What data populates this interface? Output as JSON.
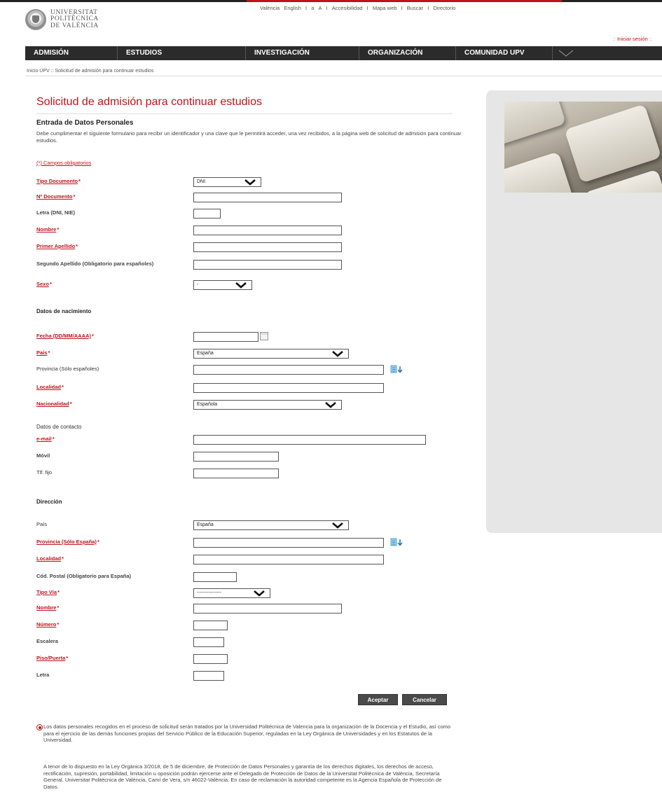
{
  "header": {
    "logo_text": [
      "UNIVERSITAT",
      "POLITÈCNICA",
      "DE VALÈNCIA"
    ],
    "top_links": [
      "València",
      "English",
      "I",
      "a",
      "A",
      "I",
      "Accesibilidad",
      "I",
      "Mapa web",
      "I",
      "Buscar",
      "I",
      "Directorio"
    ],
    "login_prefix": "::",
    "login_label": "Iniciar sesión",
    "login_suffix": "::"
  },
  "nav": {
    "items": [
      {
        "label": "ADMISIÓN"
      },
      {
        "label": "ESTUDIOS"
      },
      {
        "label": "INVESTIGACIÓN"
      },
      {
        "label": "ORGANIZACIÓN"
      },
      {
        "label": "COMUNIDAD UPV"
      }
    ]
  },
  "breadcrumb": "Inicio UPV :: Solicitud de admisión para continuar estudios",
  "page": {
    "title": "Solicitud de admisión para continuar estudios",
    "subtitle": "Entrada de Datos Personales",
    "intro": "Debe cumplimentar el siguiente formulario para recibir un identificador y una clave que le permitirá acceder, una vez recibidos, a la página web de solicitud de admisión para continuar estudios.",
    "required_note": "(*) Campos obligatorios"
  },
  "form": {
    "tipo_documento": {
      "label": "Tipo Documento",
      "value": "DNI"
    },
    "num_documento": {
      "label": "Nº Documento"
    },
    "letra": {
      "label": "Letra (DNI, NIE)"
    },
    "nombre": {
      "label": "Nombre"
    },
    "primer_apellido": {
      "label": "Primer Apellido"
    },
    "segundo_apellido": {
      "label": "Segundo Apellido (Obligatorio para españoles)"
    },
    "sexo": {
      "label": "Sexo",
      "value": "-"
    },
    "nacimiento_heading": "Datos de nacimiento",
    "fecha": {
      "label": "Fecha (DD/MM/AAAA)"
    },
    "pais_nac": {
      "label": "País",
      "value": "España"
    },
    "provincia_nac": {
      "label": "Provincia (Sólo españoles)"
    },
    "localidad_nac": {
      "label": "Localidad"
    },
    "nacionalidad": {
      "label": "Nacionalidad",
      "value": "Española"
    },
    "contacto_heading": "Datos de contacto",
    "email": {
      "label": "e-mail"
    },
    "movil": {
      "label": "Móvil"
    },
    "tlf_fijo": {
      "label": "Tlf. fijo"
    },
    "direccion_heading": "Dirección",
    "pais_dir": {
      "label": "País",
      "value": "España"
    },
    "provincia_dir": {
      "label": "Provincia (Sólo España)"
    },
    "localidad_dir": {
      "label": "Localidad"
    },
    "cod_postal": {
      "label": "Cód. Postal (Obligatorio para España)"
    },
    "tipo_via": {
      "label": "Tipo Vía",
      "value": "---------------"
    },
    "nombre_via": {
      "label": "Nombre"
    },
    "numero": {
      "label": "Número"
    },
    "escalera": {
      "label": "Escalera"
    },
    "piso_puerta": {
      "label": "Piso/Puerta"
    },
    "letra_dir": {
      "label": "Letra"
    }
  },
  "buttons": {
    "accept": "Aceptar",
    "cancel": "Cancelar"
  },
  "legal": {
    "p1": "Los datos personales recogidos en el proceso de solicitud serán tratados por la Universidad Politécnica de Valencia para la organización de la Docencia y el Estudio, así como para el ejercicio de las demás funciones propias del Servicio Público de la Educación Superior, reguladas en la Ley Orgánica de Universidades y en los Estatutos de la Universidad.",
    "p2": "A tenor de lo dispuesto en la Ley Orgánica 3/2018, de 5 de diciembre, de Protección de Datos Personales y garantía de los derechos digitales, los derechos de acceso, rectificación, supresión, portabilidad, limitación u oposición podrán ejercerse ante el Delegado de Protección de Datos de la Universitat Politècnica de València, Secretaría General. Universitat Politècnica de València, Camí de Vera, s/n 46022-València. En caso de reclamación la autoridad competente es la Agencia Española de Protección de Datos."
  },
  "colors": {
    "brand_red": "#c0121b",
    "nav_bg": "#2b2b2b",
    "side_panel": "#e6e6e6"
  }
}
